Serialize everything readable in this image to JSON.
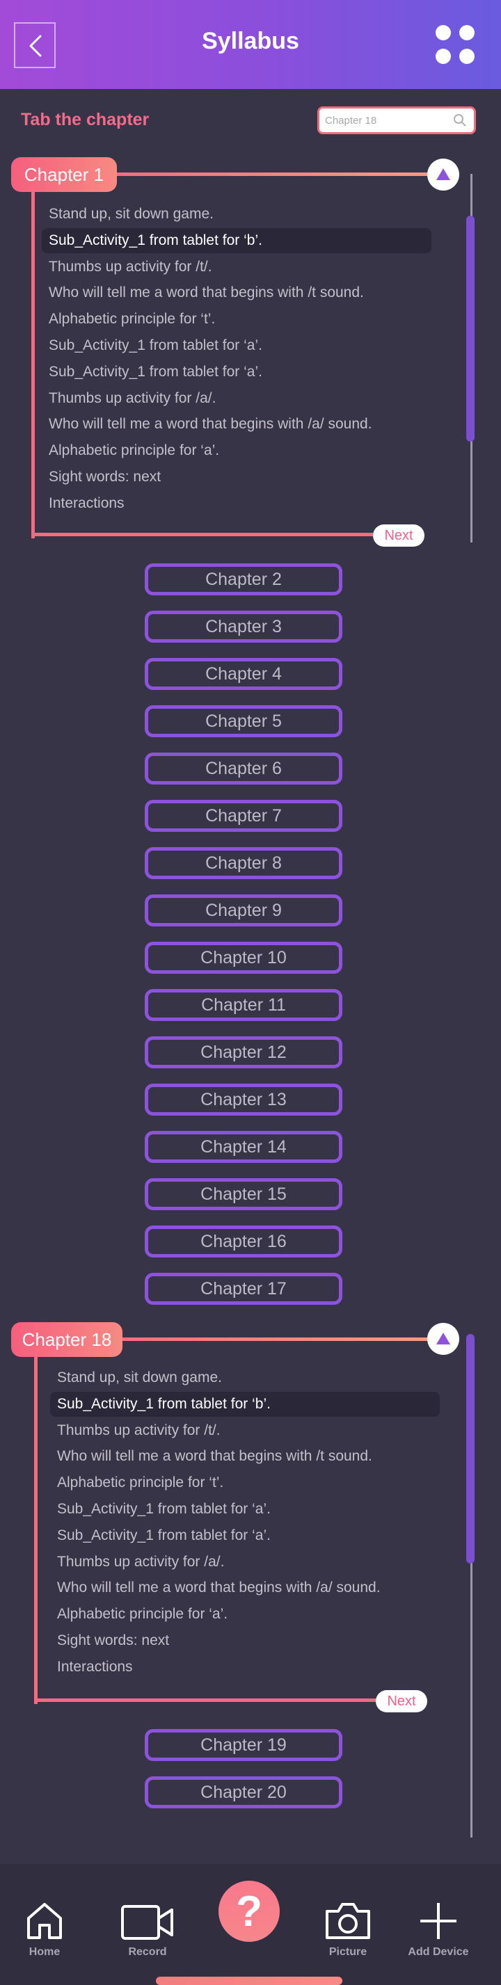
{
  "header": {
    "title": "Syllabus"
  },
  "subheader": {
    "label": "Tab the chapter",
    "search_placeholder": "Chapter 18"
  },
  "chapter_first": {
    "title": "Chapter 1",
    "next_label": "Next",
    "activities": [
      "Stand up, sit down game.",
      "Sub_Activity_1 from tablet for ‘b’.",
      "Thumbs up activity for /t/.",
      "Who will tell me a word that begins with /t sound.",
      "Alphabetic principle for ‘t’.",
      "Sub_Activity_1 from tablet for ‘a’.",
      "Sub_Activity_1 from tablet for ‘a’.",
      "Thumbs up activity for /a/.",
      "Who will tell me a word that begins with /a/ sound.",
      "Alphabetic principle for ‘a’.",
      "Sight words: next",
      "Interactions"
    ]
  },
  "chapters_collapsed_a": [
    "Chapter 2",
    "Chapter 3",
    "Chapter 4",
    "Chapter 5",
    "Chapter 6",
    "Chapter 7",
    "Chapter 8",
    "Chapter 9",
    "Chapter 10",
    "Chapter 11",
    "Chapter 12",
    "Chapter 13",
    "Chapter 14",
    "Chapter 15",
    "Chapter 16",
    "Chapter 17"
  ],
  "chapter_second": {
    "title": "Chapter 18",
    "next_label": "Next",
    "activities": [
      "Stand up, sit down game.",
      "Sub_Activity_1 from tablet for ‘b’.",
      "Thumbs up activity for /t/.",
      "Who will tell me a word that begins with /t sound.",
      "Alphabetic principle for ‘t’.",
      "Sub_Activity_1 from tablet for ‘a’.",
      "Sub_Activity_1 from tablet for ‘a’.",
      "Thumbs up activity for /a/.",
      "Who will tell me a word that begins with /a/ sound.",
      "Alphabetic principle for ‘a’.",
      "Sight words: next",
      "Interactions"
    ]
  },
  "chapters_collapsed_b": [
    "Chapter 19",
    "Chapter 20"
  ],
  "nav": {
    "home": "Home",
    "record": "Record",
    "help": "?",
    "picture": "Picture",
    "add_device": "Add Device"
  },
  "colors": {
    "accent_pink": "#f66b82",
    "accent_purple": "#8d53dd",
    "background": "#383447"
  }
}
